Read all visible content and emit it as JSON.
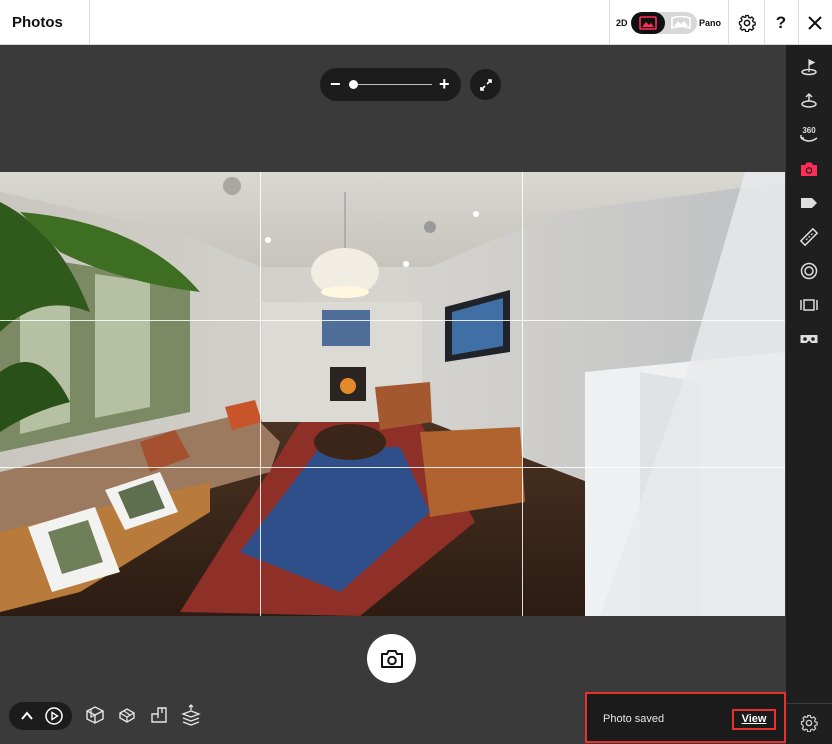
{
  "header": {
    "title": "Photos",
    "mode_2d_label": "2D",
    "mode_pano_label": "Pano",
    "help_label": "?"
  },
  "sidebar": {
    "items": [
      {
        "name": "tour-start-icon"
      },
      {
        "name": "floor-icon"
      },
      {
        "name": "360-view-icon",
        "label": "360"
      },
      {
        "name": "camera-icon",
        "active": true
      },
      {
        "name": "tag-icon"
      },
      {
        "name": "ruler-icon"
      },
      {
        "name": "target-icon"
      },
      {
        "name": "frame-icon"
      },
      {
        "name": "vr-headset-icon"
      }
    ],
    "settings_icon": "gear-icon"
  },
  "zoom": {
    "minus_label": "−",
    "plus_label": "+",
    "level": 0.0
  },
  "photo": {
    "grid": "rule-of-thirds"
  },
  "toolbar": {
    "collapse_icon": "chevron-up-icon",
    "play_icon": "play-icon",
    "views": [
      "dollhouse-icon",
      "floorplan-3d-icon",
      "floorplan-icon",
      "floors-icon"
    ]
  },
  "toast": {
    "message": "Photo saved",
    "action_label": "View"
  },
  "colors": {
    "accent": "#e8312a",
    "active_icon": "#ff2d55",
    "sidebar_bg": "#1f1f1f",
    "workspace_bg": "#3a3a3a"
  }
}
